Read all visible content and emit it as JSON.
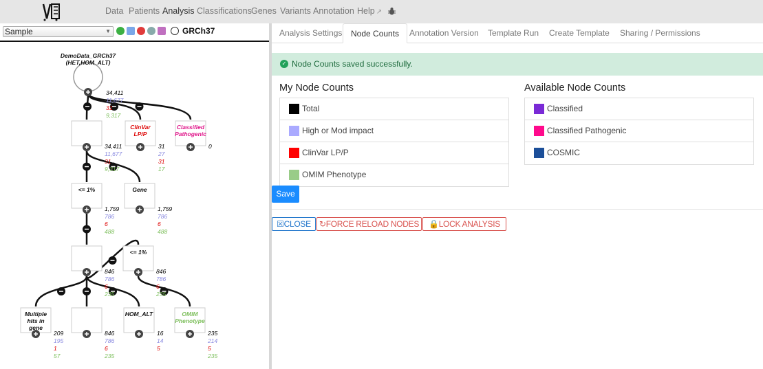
{
  "nav": {
    "items": [
      "Data",
      "Patients",
      "Analysis",
      "Classifications",
      "Genes",
      "Variants",
      "Annotation",
      "Help"
    ],
    "active": "Analysis",
    "help_icon": "external-link-icon",
    "bug_icon": "bug-icon"
  },
  "left": {
    "sample_select": "Sample",
    "genome_build": "GRCh37",
    "nodes": [
      {
        "name": "source",
        "label": "DemoData_GRCh37\n(HET,HOM_ALT)",
        "counts": [
          "34,411",
          "11,677",
          "31",
          "9,317"
        ]
      },
      {
        "name": "variant-filter",
        "label": "",
        "counts": [
          "34,411",
          "11,677",
          "31",
          "9,317"
        ]
      },
      {
        "name": "clinvar",
        "label": "ClinVar\nLP/P",
        "counts": [
          "31",
          "27",
          "31",
          "17"
        ]
      },
      {
        "name": "classified-pathogenic",
        "label": "Classified\nPathogenic",
        "counts": [
          "0"
        ]
      },
      {
        "name": "pop-frequency",
        "label": "<= 1%",
        "counts": [
          "1,759",
          "786",
          "6",
          "488"
        ]
      },
      {
        "name": "gene-list",
        "label": "Gene",
        "counts": [
          "1,759",
          "786",
          "6",
          "488"
        ]
      },
      {
        "name": "damage",
        "label": "",
        "counts": [
          "846",
          "786",
          "6",
          "235"
        ]
      },
      {
        "name": "pop-frequency-2",
        "label": "<= 1%",
        "counts": [
          "846",
          "786",
          "6",
          "235"
        ]
      },
      {
        "name": "compound-het",
        "label": "Multiple\nhits in\ngene",
        "counts": [
          "209",
          "195",
          "1",
          "57"
        ]
      },
      {
        "name": "pedigree",
        "label": "",
        "counts": [
          "846",
          "786",
          "6",
          "235"
        ]
      },
      {
        "name": "zygosity",
        "label": "HOM_ALT",
        "counts": [
          "16",
          "14",
          "5"
        ]
      },
      {
        "name": "omim",
        "label": "OMIM\nPhenotype",
        "counts": [
          "235",
          "214",
          "5",
          "235"
        ]
      }
    ],
    "count_colors": [
      "#000000",
      "#8a8ae0",
      "#dd0000",
      "#7dbf5c"
    ]
  },
  "tabs": [
    "Analysis Settings",
    "Node Counts",
    "Annotation Version",
    "Template Run",
    "Create Template",
    "Sharing / Permissions"
  ],
  "active_tab": "Node Counts",
  "alert": "Node Counts saved successfully.",
  "my_counts": {
    "title": "My Node Counts",
    "items": [
      {
        "label": "Total",
        "color": "#000000"
      },
      {
        "label": "High or Mod impact",
        "color": "#aaaaff"
      },
      {
        "label": "ClinVar LP/P",
        "color": "#ff0000"
      },
      {
        "label": "OMIM Phenotype",
        "color": "#99cc88"
      }
    ]
  },
  "available_counts": {
    "title": "Available Node Counts",
    "items": [
      {
        "label": "Classified",
        "color": "#7a2ad6"
      },
      {
        "label": "Classified Pathogenic",
        "color": "#ff0a8c"
      },
      {
        "label": "COSMIC",
        "color": "#1c4f99"
      }
    ]
  },
  "buttons": {
    "save": "Save",
    "close": "CLOSE",
    "reload": "FORCE RELOAD NODES",
    "lock": "LOCK ANALYSIS"
  }
}
